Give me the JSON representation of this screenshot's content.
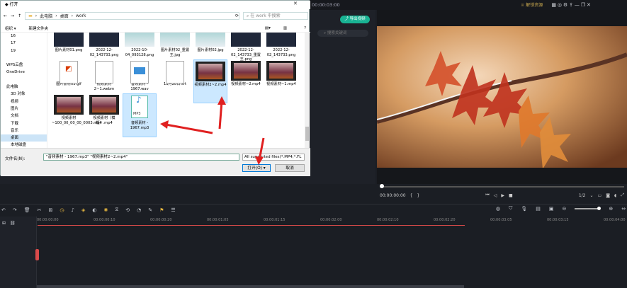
{
  "editor": {
    "time_top": "00:00:03:00",
    "top_right": {
      "resource_label": "解锁资源"
    },
    "export_label": "导出视频",
    "search_placeholder": "搜索关键词",
    "player": {
      "time": "00:00:00:00",
      "ratio": "1/2",
      "progress_percent": 0
    },
    "ruler_ticks": [
      "00:00:00:00",
      "00:00:00:10",
      "00:00:00:20",
      "00:00:01:05",
      "00:00:01:15",
      "00:00:02:00",
      "00:00:02:10",
      "00:00:02:20",
      "00:00:03:05",
      "00:00:03:15",
      "00:00:04:00"
    ]
  },
  "dialog": {
    "title": "打开",
    "path": [
      "此电脑",
      "桌面",
      "work"
    ],
    "search_placeholder": "在 work 中搜索",
    "commands": {
      "organize": "组织 ▾",
      "new_folder": "新建文件夹"
    },
    "nav_items": [
      {
        "label": "16",
        "indent": 1
      },
      {
        "label": "17",
        "indent": 1
      },
      {
        "label": "19",
        "indent": 1
      },
      {
        "label": "",
        "indent": 1
      },
      {
        "label": "WPS云盘",
        "indent": 0
      },
      {
        "label": "OneDrive",
        "indent": 0
      },
      {
        "label": "",
        "indent": 0
      },
      {
        "label": "此电脑",
        "indent": 0
      },
      {
        "label": "3D 对象",
        "indent": 1
      },
      {
        "label": "视频",
        "indent": 1
      },
      {
        "label": "图片",
        "indent": 1
      },
      {
        "label": "文档",
        "indent": 1
      },
      {
        "label": "下载",
        "indent": 1
      },
      {
        "label": "音乐",
        "indent": 1
      },
      {
        "label": "桌面",
        "indent": 1,
        "selected": true
      },
      {
        "label": "本地磁盘",
        "indent": 1
      }
    ],
    "files": [
      {
        "name": "图片素材01.png",
        "kind": "img-dark",
        "col": 0,
        "row": 0
      },
      {
        "name": "2022-12-02_143733.png",
        "kind": "img-dark",
        "col": 1,
        "row": 0
      },
      {
        "name": "2022-10-04_093128.png",
        "kind": "img-light",
        "col": 2,
        "row": 0
      },
      {
        "name": "图片素材02_重置王.jpg",
        "kind": "img-light",
        "col": 3,
        "row": 0
      },
      {
        "name": "图片素材02.jpg",
        "kind": "img-light",
        "col": 4,
        "row": 0
      },
      {
        "name": "2022-12-02_143733_重置王.png",
        "kind": "img-dark",
        "col": 5,
        "row": 0
      },
      {
        "name": "2022-12-02_143733.png",
        "kind": "img-dark",
        "col": 6,
        "row": 0
      },
      {
        "name": "图片素材03.gif",
        "kind": "office",
        "col": 0,
        "row": 1
      },
      {
        "name": "视频素材2~1.webm",
        "kind": "blank",
        "col": 1,
        "row": 1
      },
      {
        "name": "音频素材 - 1967.wav",
        "kind": "wav",
        "col": 2,
        "row": 1
      },
      {
        "name": "11月28日.srt",
        "kind": "blank",
        "col": 3,
        "row": 1
      },
      {
        "name": "视频素材2~2.mp4",
        "kind": "film",
        "col": 4,
        "row": 1,
        "selected": true
      },
      {
        "name": "视频素材~2.mp4",
        "kind": "film",
        "col": 5,
        "row": 1
      },
      {
        "name": "视频素材~1.mp4",
        "kind": "film",
        "col": 6,
        "row": 1
      },
      {
        "name": "视频素材~100_00_00_00_0003.mp4",
        "kind": "film",
        "col": 0,
        "row": 2
      },
      {
        "name": "视频素材（模糊）.mp4",
        "kind": "film",
        "col": 1,
        "row": 2
      },
      {
        "name": "音频素材 - 1967.mp3",
        "kind": "mp3",
        "col": 2,
        "row": 2,
        "selected": true
      }
    ],
    "filename_label": "文件名(N):",
    "filename_value": "\"音频素材 - 1967.mp3\" \"视频素材2~2.mp4\"",
    "filetype_value": "All supported files(*.MP4;*.FL",
    "open_label": "打开(O)",
    "cancel_label": "取消",
    "mp3_badge": "MP3"
  }
}
